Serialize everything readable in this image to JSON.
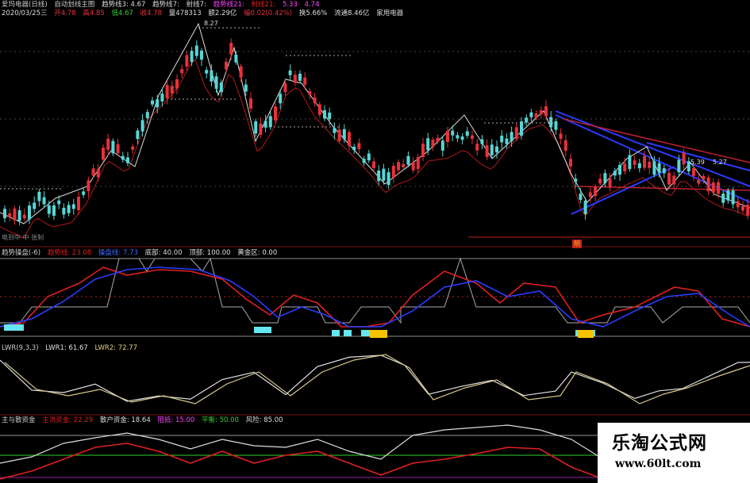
{
  "colors": {
    "up": "#e8313a",
    "down": "#58d6d6",
    "red": "#e02020",
    "blue": "#2a3cff",
    "white": "#e0e0e0",
    "yellow": "#f5c400",
    "gold": "#d6b800",
    "magenta": "#ff40ff",
    "green": "#30d030"
  },
  "main": {
    "row1": [
      "爱玛电器(日线)",
      "自动划线主图",
      "趋势线3: 4.67",
      "趋势线7:",
      "射线7:",
      "趋势线21:",
      "射线21:",
      "5.33",
      "4.74"
    ],
    "row2": [
      "2020/03/25三",
      "开4.78",
      "高4.85",
      "低4.67",
      "收4.78",
      "量478313",
      "额2.29亿",
      "幅0.02(0.42%)",
      "换5.66%",
      "流通8.46亿",
      "家用电器"
    ],
    "high_label": "8.27",
    "right_label1": "5.39",
    "right_label2": "5.27",
    "bottom_left": "电到中 中 张制",
    "marker": "阴"
  },
  "sub1": {
    "items": [
      "趋势操盘(-6)",
      "趋势线: 23.08",
      "操盘线: 7.73",
      "底部: 40.00",
      "顶部: 100.00",
      "黄金区: 0.00"
    ]
  },
  "sub2": {
    "items": [
      "LWR(9,3,3)",
      "LWR1: 61.67",
      "LWR2: 72.77"
    ]
  },
  "sub3": {
    "items": [
      "主与散资金",
      "主流资金: 22.29",
      "散户资金: 18.64",
      "阻抵: 15.00",
      "平衡: 50.00",
      "风险: 85.00"
    ]
  },
  "watermark": {
    "title": "乐淘公式网",
    "url": "www.60lt.com"
  }
}
